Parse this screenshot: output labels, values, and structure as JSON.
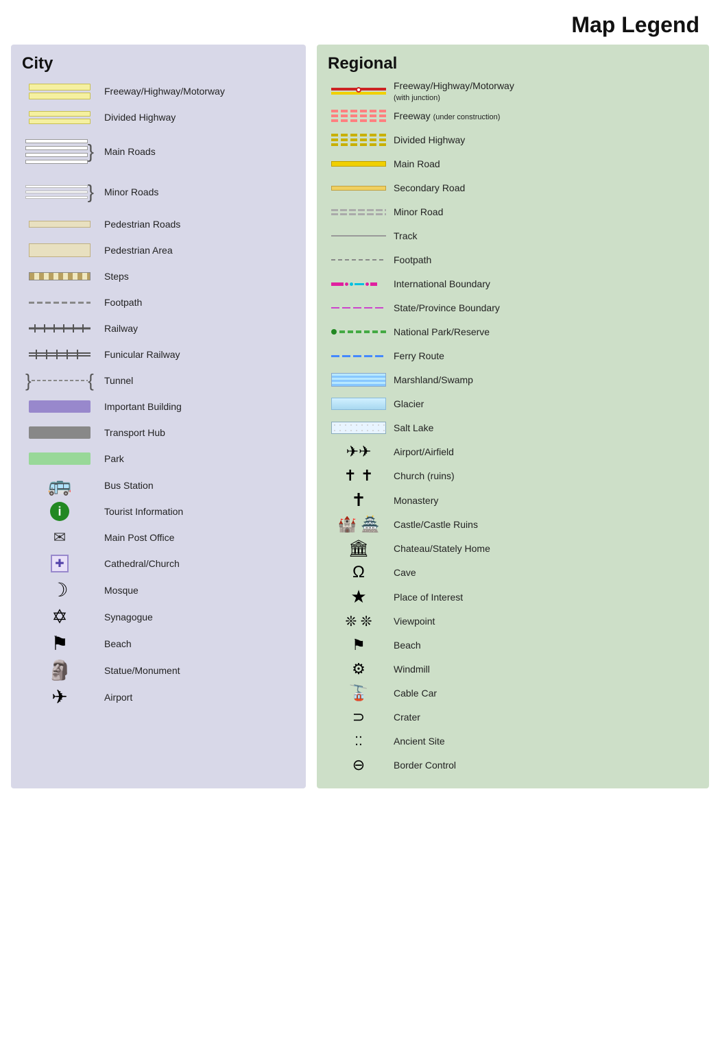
{
  "title": "Map Legend",
  "city": {
    "title": "City",
    "items": [
      {
        "id": "freeway-city",
        "label": "Freeway/Highway/Motorway"
      },
      {
        "id": "divided-hwy-city",
        "label": "Divided Highway"
      },
      {
        "id": "main-roads-city",
        "label": "Main Roads"
      },
      {
        "id": "minor-roads-city",
        "label": "Minor Roads"
      },
      {
        "id": "pedestrian-roads",
        "label": "Pedestrian Roads"
      },
      {
        "id": "pedestrian-area",
        "label": "Pedestrian Area"
      },
      {
        "id": "steps",
        "label": "Steps"
      },
      {
        "id": "footpath",
        "label": "Footpath"
      },
      {
        "id": "railway",
        "label": "Railway"
      },
      {
        "id": "funicular",
        "label": "Funicular Railway"
      },
      {
        "id": "tunnel",
        "label": "Tunnel"
      },
      {
        "id": "important-building",
        "label": "Important Building"
      },
      {
        "id": "transport-hub",
        "label": "Transport Hub"
      },
      {
        "id": "park",
        "label": "Park"
      },
      {
        "id": "bus-station",
        "label": "Bus Station"
      },
      {
        "id": "tourist-info",
        "label": "Tourist Information"
      },
      {
        "id": "main-post-office",
        "label": "Main Post Office"
      },
      {
        "id": "cathedral-church",
        "label": "Cathedral/Church"
      },
      {
        "id": "mosque",
        "label": "Mosque"
      },
      {
        "id": "synagogue",
        "label": "Synagogue"
      },
      {
        "id": "beach-city",
        "label": "Beach"
      },
      {
        "id": "statue-monument",
        "label": "Statue/Monument"
      },
      {
        "id": "airport-city",
        "label": "Airport"
      }
    ]
  },
  "regional": {
    "title": "Regional",
    "items": [
      {
        "id": "freeway-reg",
        "label": "Freeway/Highway/Motorway",
        "sub": "(with junction)"
      },
      {
        "id": "freeway-uc",
        "label": "Freeway",
        "sub": "(under construction)"
      },
      {
        "id": "divided-hwy-reg",
        "label": "Divided Highway"
      },
      {
        "id": "main-road-reg",
        "label": "Main Road"
      },
      {
        "id": "secondary-road",
        "label": "Secondary Road"
      },
      {
        "id": "minor-road-reg",
        "label": "Minor Road"
      },
      {
        "id": "track",
        "label": "Track"
      },
      {
        "id": "footpath-reg",
        "label": "Footpath"
      },
      {
        "id": "intl-boundary",
        "label": "International Boundary"
      },
      {
        "id": "state-boundary",
        "label": "State/Province Boundary"
      },
      {
        "id": "natl-park",
        "label": "National Park/Reserve"
      },
      {
        "id": "ferry-route",
        "label": "Ferry Route"
      },
      {
        "id": "marshland",
        "label": "Marshland/Swamp"
      },
      {
        "id": "glacier",
        "label": "Glacier"
      },
      {
        "id": "salt-lake",
        "label": "Salt Lake"
      },
      {
        "id": "airport-airfield",
        "label": "Airport/Airfield"
      },
      {
        "id": "church-ruins",
        "label": "Church (ruins)"
      },
      {
        "id": "monastery",
        "label": "Monastery"
      },
      {
        "id": "castle",
        "label": "Castle/Castle Ruins"
      },
      {
        "id": "chateau",
        "label": "Chateau/Stately Home"
      },
      {
        "id": "cave",
        "label": "Cave"
      },
      {
        "id": "place-of-interest",
        "label": "Place of Interest"
      },
      {
        "id": "viewpoint",
        "label": "Viewpoint"
      },
      {
        "id": "beach-reg",
        "label": "Beach"
      },
      {
        "id": "windmill",
        "label": "Windmill"
      },
      {
        "id": "cable-car",
        "label": "Cable Car"
      },
      {
        "id": "crater",
        "label": "Crater"
      },
      {
        "id": "ancient-site",
        "label": "Ancient Site"
      },
      {
        "id": "border-control",
        "label": "Border Control"
      }
    ]
  }
}
